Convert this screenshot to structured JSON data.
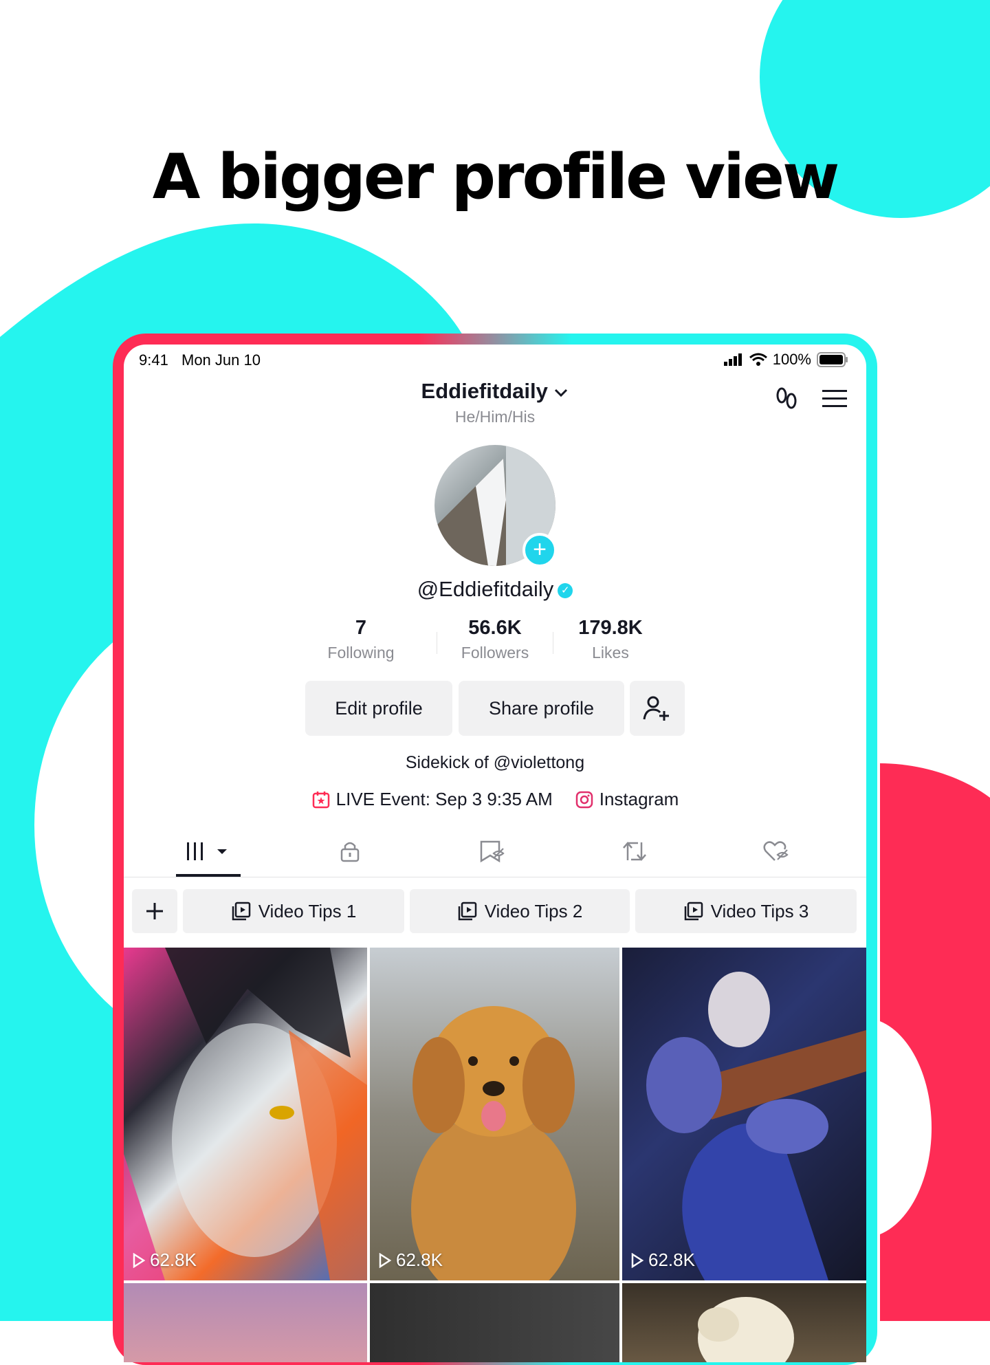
{
  "headline": "A bigger profile view",
  "colors": {
    "cyan": "#25f4ee",
    "red": "#fe2c55",
    "accent": "#20d5ec",
    "text": "#161823",
    "muted": "#8a8b91"
  },
  "status_bar": {
    "time": "9:41",
    "date": "Mon Jun 10",
    "battery": "100%"
  },
  "profile": {
    "username": "Eddiefitdaily",
    "pronouns": "He/Him/His",
    "handle": "@Eddiefitdaily",
    "verified": true,
    "stats": [
      {
        "value": "7",
        "label": "Following"
      },
      {
        "value": "56.6K",
        "label": "Followers"
      },
      {
        "value": "179.8K",
        "label": "Likes"
      }
    ],
    "bio": "Sidekick of @violettong",
    "links": [
      {
        "icon": "calendar-star-icon",
        "text": "LIVE Event: Sep 3 9:35 AM"
      },
      {
        "icon": "instagram-icon",
        "text": "Instagram"
      }
    ]
  },
  "buttons": {
    "edit": "Edit profile",
    "share": "Share profile"
  },
  "tabs": [
    "videos-grid-tab",
    "private-tab",
    "saved-hidden-tab",
    "reposts-tab",
    "liked-hidden-tab"
  ],
  "playlists": [
    {
      "label": "Video Tips 1"
    },
    {
      "label": "Video Tips 2"
    },
    {
      "label": "Video Tips 3"
    }
  ],
  "videos": [
    {
      "views": "62.8K",
      "subject": "painted face portrait"
    },
    {
      "views": "62.8K",
      "subject": "golden retriever"
    },
    {
      "views": "62.8K",
      "subject": "guitarist"
    }
  ]
}
